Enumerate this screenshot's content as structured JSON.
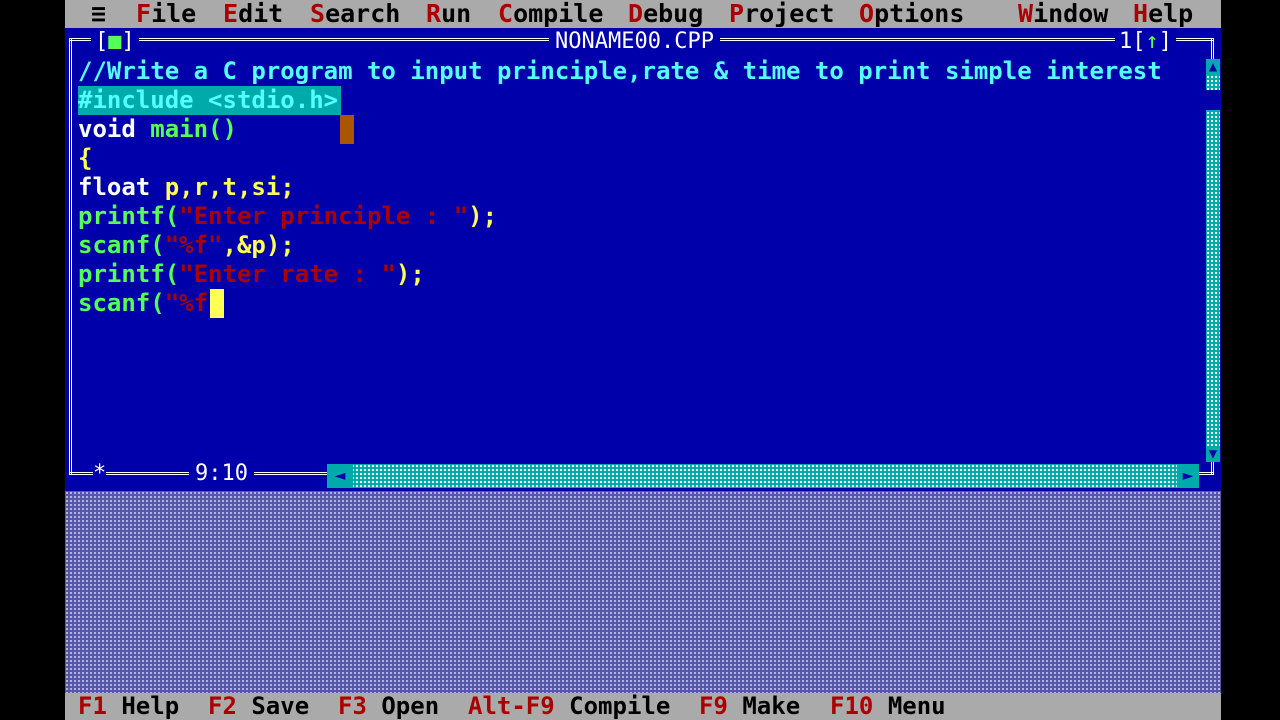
{
  "menu": {
    "system": "≡",
    "items": [
      {
        "hot": "F",
        "rest": "ile"
      },
      {
        "hot": "E",
        "rest": "dit"
      },
      {
        "hot": "S",
        "rest": "earch"
      },
      {
        "hot": "R",
        "rest": "un"
      },
      {
        "hot": "C",
        "rest": "ompile"
      },
      {
        "hot": "D",
        "rest": "ebug"
      },
      {
        "hot": "P",
        "rest": "roject"
      },
      {
        "hot": "O",
        "rest": "ptions"
      },
      {
        "hot": "W",
        "rest": "indow"
      },
      {
        "hot": "H",
        "rest": "elp"
      }
    ]
  },
  "window": {
    "close_left": "[",
    "close_mark": "■",
    "close_right": "]",
    "title": "NONAME00.CPP",
    "number": "1",
    "zoom_left": "[",
    "zoom_mark": "↑",
    "zoom_right": "]",
    "resize_mark": "*",
    "position": "9:10"
  },
  "code": {
    "line1": "//Write a C program to input principle,rate & time to print simple interest",
    "line2": "#include <stdio.h>",
    "line3_kw": "void",
    "line3_fn": "main()",
    "line4": "{",
    "line5_kw": "float",
    "line5_rest": "p,r,t,si;",
    "line6_fn": "printf(",
    "line6_str": "\"Enter principle : \"",
    "line6_end": ");",
    "line7_fn": "scanf(",
    "line7_str": "\"%f\"",
    "line7_end": ",&p);",
    "line8_fn": "printf(",
    "line8_str": "\"Enter rate : \"",
    "line8_end": ");",
    "line9_fn": "scanf(",
    "line9_str": "\"%f"
  },
  "status": {
    "items": [
      {
        "key": "F1",
        "label": "Help"
      },
      {
        "key": "F2",
        "label": "Save"
      },
      {
        "key": "F3",
        "label": "Open"
      },
      {
        "key": "Alt-F9",
        "label": "Compile"
      },
      {
        "key": "F9",
        "label": "Make"
      },
      {
        "key": "F10",
        "label": "Menu"
      }
    ]
  },
  "colors": {
    "editor_bg": "#0000aa",
    "menu_bg": "#aaaaaa",
    "hotkey": "#aa0000",
    "comment": "#55ffff",
    "string": "#aa0000"
  }
}
